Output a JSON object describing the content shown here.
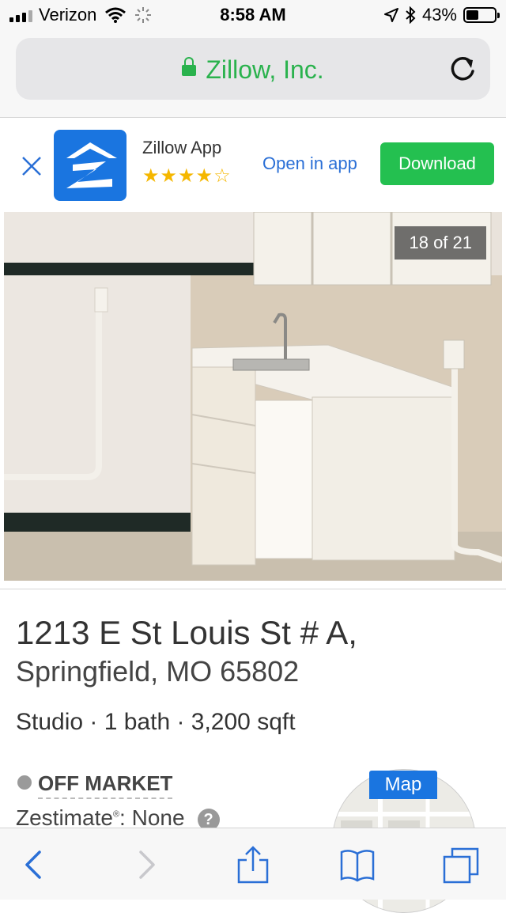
{
  "status_bar": {
    "carrier": "Verizon",
    "time": "8:58 AM",
    "battery": "43%",
    "battery_level": 0.43,
    "icons": [
      "signal-icon",
      "wifi-icon",
      "activity-icon",
      "location-arrow-icon",
      "bluetooth-icon",
      "battery-icon"
    ]
  },
  "browser": {
    "url_host": "Zillow, Inc.",
    "icons": [
      "lock-icon",
      "reload-icon"
    ],
    "accent_green": "#2ab24d"
  },
  "app_banner": {
    "app_name": "Zillow App",
    "stars_filled": "★★★★",
    "stars_empty": "☆",
    "rating": 4,
    "open_label": "Open in app",
    "download_label": "Download",
    "icons": [
      "close-icon",
      "zillow-logo-icon"
    ],
    "colors": {
      "download": "#24c050",
      "link": "#2a6fd6",
      "brand": "#1a75e0"
    }
  },
  "photo": {
    "counter": "18 of 21"
  },
  "listing": {
    "address_line1": "1213 E St Louis St # A,",
    "address_line2": "Springfield, MO 65802",
    "facts": "Studio · 1 bath · 3,200 sqft",
    "status": "OFF MARKET",
    "zestimate_label": "Zestimate",
    "zestimate_mark": "®",
    "zestimate_value": ": None",
    "help_symbol": "?",
    "map_label": "Map"
  },
  "toolbar": {
    "icons": [
      "back-icon",
      "forward-icon",
      "share-icon",
      "bookmarks-icon",
      "tabs-icon"
    ]
  }
}
